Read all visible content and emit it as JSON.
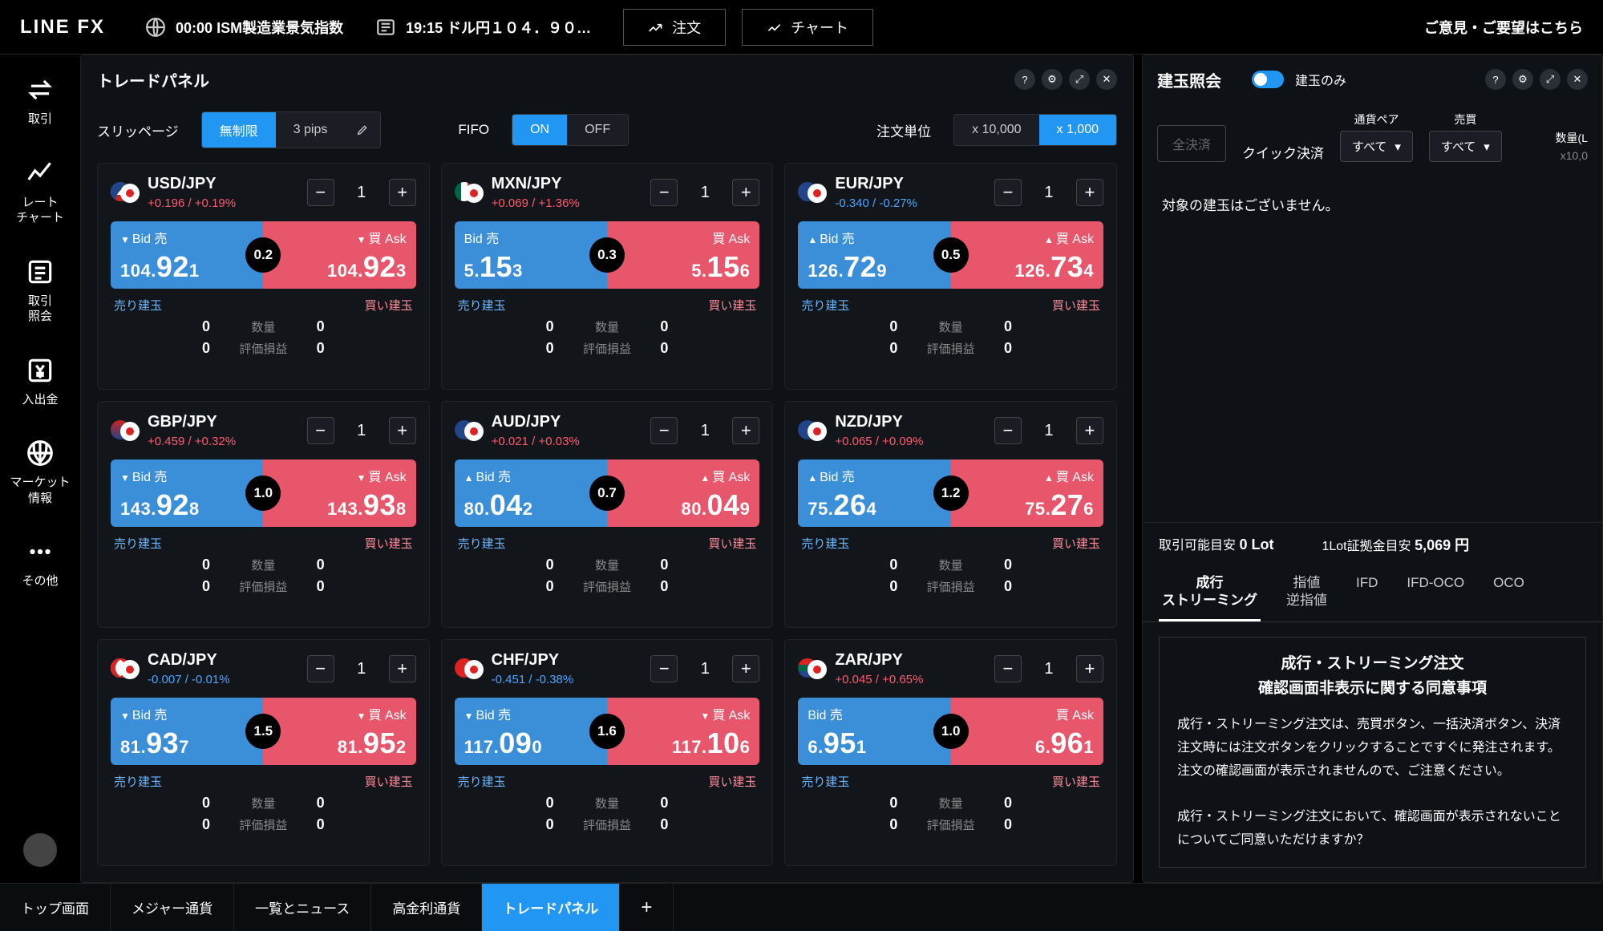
{
  "header": {
    "logo": "LINE FX",
    "indicator_time": "00:00",
    "indicator_name": "ISM製造業景気指数",
    "news_time": "19:15",
    "news_text": "ドル円１０４．９０…",
    "order_btn": "注文",
    "chart_btn": "チャート",
    "feedback": "ご意見・ご要望はこちら"
  },
  "sidenav": [
    {
      "label": "取引"
    },
    {
      "label": "レート\nチャート"
    },
    {
      "label": "取引\n照会"
    },
    {
      "label": "入出金"
    },
    {
      "label": "マーケット\n情報"
    },
    {
      "label": "その他"
    }
  ],
  "trade_panel": {
    "title": "トレードパネル",
    "slippage_label": "スリッページ",
    "slippage_options": [
      "無制限",
      "3 pips"
    ],
    "fifo_label": "FIFO",
    "fifo_options": [
      "ON",
      "OFF"
    ],
    "order_unit_label": "注文単位",
    "order_unit_options": [
      "x 10,000",
      "x 1,000"
    ],
    "legend": {
      "bid": "Bid 売",
      "ask": "買 Ask",
      "sell_pos": "売り建玉",
      "buy_pos": "買い建玉",
      "qty": "数量",
      "pl": "評価損益"
    }
  },
  "pairs": [
    {
      "name": "USD/JPY",
      "flags": [
        "us",
        "jp"
      ],
      "change": "+0.196 / +0.19%",
      "dir": "pos",
      "bid": "104.",
      "bid_big": "92",
      "bid_sm": "1",
      "ask": "104.",
      "ask_big": "92",
      "ask_sm": "3",
      "spread": "0.2",
      "bid_tri": "dn",
      "ask_tri": "dn",
      "qty": "1",
      "sell_qty": "0",
      "buy_qty": "0",
      "sell_pl": "0",
      "buy_pl": "0"
    },
    {
      "name": "MXN/JPY",
      "flags": [
        "mx",
        "jp"
      ],
      "change": "+0.069 / +1.36%",
      "dir": "pos",
      "bid": "5.",
      "bid_big": "15",
      "bid_sm": "3",
      "ask": "5.",
      "ask_big": "15",
      "ask_sm": "6",
      "spread": "0.3",
      "bid_tri": "",
      "ask_tri": "",
      "qty": "1",
      "sell_qty": "0",
      "buy_qty": "0",
      "sell_pl": "0",
      "buy_pl": "0"
    },
    {
      "name": "EUR/JPY",
      "flags": [
        "eu",
        "jp"
      ],
      "change": "-0.340 / -0.27%",
      "dir": "neg",
      "bid": "126.",
      "bid_big": "72",
      "bid_sm": "9",
      "ask": "126.",
      "ask_big": "73",
      "ask_sm": "4",
      "spread": "0.5",
      "bid_tri": "up",
      "ask_tri": "up",
      "qty": "1",
      "sell_qty": "0",
      "buy_qty": "0",
      "sell_pl": "0",
      "buy_pl": "0"
    },
    {
      "name": "GBP/JPY",
      "flags": [
        "gb",
        "jp"
      ],
      "change": "+0.459 / +0.32%",
      "dir": "pos",
      "bid": "143.",
      "bid_big": "92",
      "bid_sm": "8",
      "ask": "143.",
      "ask_big": "93",
      "ask_sm": "8",
      "spread": "1.0",
      "bid_tri": "dn",
      "ask_tri": "dn",
      "qty": "1",
      "sell_qty": "0",
      "buy_qty": "0",
      "sell_pl": "0",
      "buy_pl": "0"
    },
    {
      "name": "AUD/JPY",
      "flags": [
        "au",
        "jp"
      ],
      "change": "+0.021 / +0.03%",
      "dir": "pos",
      "bid": "80.",
      "bid_big": "04",
      "bid_sm": "2",
      "ask": "80.",
      "ask_big": "04",
      "ask_sm": "9",
      "spread": "0.7",
      "bid_tri": "up",
      "ask_tri": "up",
      "qty": "1",
      "sell_qty": "0",
      "buy_qty": "0",
      "sell_pl": "0",
      "buy_pl": "0"
    },
    {
      "name": "NZD/JPY",
      "flags": [
        "nz",
        "jp"
      ],
      "change": "+0.065 / +0.09%",
      "dir": "pos",
      "bid": "75.",
      "bid_big": "26",
      "bid_sm": "4",
      "ask": "75.",
      "ask_big": "27",
      "ask_sm": "6",
      "spread": "1.2",
      "bid_tri": "up",
      "ask_tri": "up",
      "qty": "1",
      "sell_qty": "0",
      "buy_qty": "0",
      "sell_pl": "0",
      "buy_pl": "0"
    },
    {
      "name": "CAD/JPY",
      "flags": [
        "ca",
        "jp"
      ],
      "change": "-0.007 / -0.01%",
      "dir": "neg",
      "bid": "81.",
      "bid_big": "93",
      "bid_sm": "7",
      "ask": "81.",
      "ask_big": "95",
      "ask_sm": "2",
      "spread": "1.5",
      "bid_tri": "dn",
      "ask_tri": "dn",
      "qty": "1",
      "sell_qty": "0",
      "buy_qty": "0",
      "sell_pl": "0",
      "buy_pl": "0"
    },
    {
      "name": "CHF/JPY",
      "flags": [
        "ch",
        "jp"
      ],
      "change": "-0.451 / -0.38%",
      "dir": "neg",
      "bid": "117.",
      "bid_big": "09",
      "bid_sm": "0",
      "ask": "117.",
      "ask_big": "10",
      "ask_sm": "6",
      "spread": "1.6",
      "bid_tri": "dn",
      "ask_tri": "dn",
      "qty": "1",
      "sell_qty": "0",
      "buy_qty": "0",
      "sell_pl": "0",
      "buy_pl": "0"
    },
    {
      "name": "ZAR/JPY",
      "flags": [
        "za",
        "jp"
      ],
      "change": "+0.045 / +0.65%",
      "dir": "pos",
      "bid": "6.",
      "bid_big": "95",
      "bid_sm": "1",
      "ask": "6.",
      "ask_big": "96",
      "ask_sm": "1",
      "spread": "1.0",
      "bid_tri": "",
      "ask_tri": "",
      "qty": "1",
      "sell_qty": "0",
      "buy_qty": "0",
      "sell_pl": "0",
      "buy_pl": "0"
    }
  ],
  "positions": {
    "title": "建玉照会",
    "toggle_label": "建玉のみ",
    "settle_all": "全決済",
    "quick_settle": "クイック決済",
    "dd_pair_label": "通貨ペア",
    "dd_pair_value": "すべて",
    "dd_side_label": "売買",
    "dd_side_value": "すべて",
    "qty_header": "数量(L",
    "qty_unit": "x10,0",
    "empty": "対象の建玉はございません。"
  },
  "order": {
    "margin_label": "取引可能目安",
    "margin_value": "0 Lot",
    "est_margin_label": "1Lot証拠金目安",
    "est_margin_value": "5,069 円",
    "tabs": [
      "成行\nストリーミング",
      "指値\n逆指値",
      "IFD",
      "IFD-OCO",
      "OCO"
    ],
    "consent_title": "成行・ストリーミング注文\n確認画面非表示に関する同意事項",
    "consent_body": "成行・ストリーミング注文は、売買ボタン、一括決済ボタン、決済注文時には注文ボタンをクリックすることですぐに発注されます。\n注文の確認画面が表示されませんので、ご注意ください。\n\n成行・ストリーミング注文において、確認画面が表示されないことについてご同意いただけますか？"
  },
  "bottom_tabs": [
    "トップ画面",
    "メジャー通貨",
    "一覧とニュース",
    "高金利通貨",
    "トレードパネル"
  ]
}
